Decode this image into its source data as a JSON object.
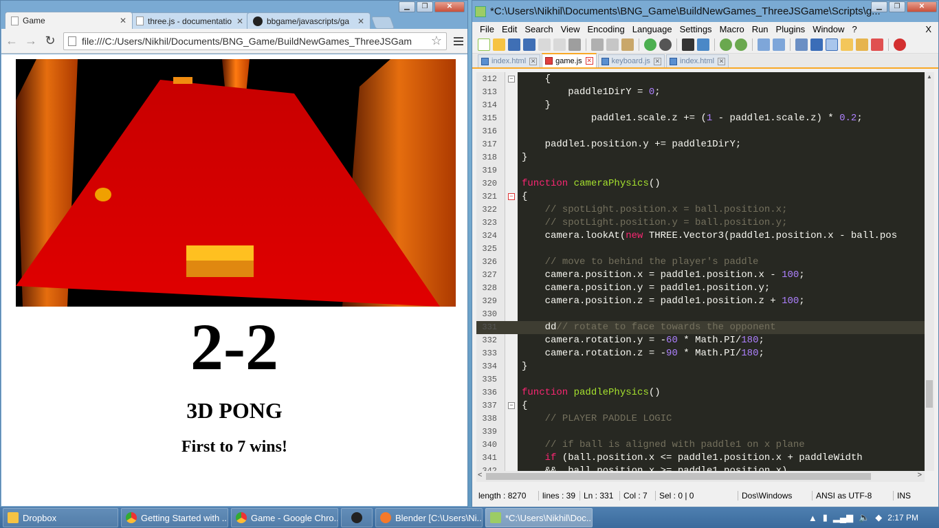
{
  "browser": {
    "tabs": [
      {
        "label": "Game",
        "icon": "page-icon"
      },
      {
        "label": "three.js - documentatio",
        "icon": "page-icon"
      },
      {
        "label": "bbgame/javascripts/ga",
        "icon": "github-icon"
      }
    ],
    "address": "file:///C:/Users/Nikhil/Documents/BNG_Game/BuildNewGames_ThreeJSGam",
    "page": {
      "score": "2-2",
      "title": "3D PONG",
      "subtitle": "First to 7 wins!"
    }
  },
  "editor": {
    "window_title": "*C:\\Users\\Nikhil\\Documents\\BNG_Game\\BuildNewGames_ThreeJSGame\\Scripts\\g...",
    "menu": [
      "File",
      "Edit",
      "Search",
      "View",
      "Encoding",
      "Language",
      "Settings",
      "Macro",
      "Run",
      "Plugins",
      "Window",
      "?"
    ],
    "close_x": "X",
    "tabs": [
      {
        "label": "index.html",
        "active": false
      },
      {
        "label": "game.js",
        "active": true
      },
      {
        "label": "keyboard.js",
        "active": false
      },
      {
        "label": "index.html",
        "active": false
      }
    ],
    "status": {
      "length": "length : 8270",
      "lines": "lines : 39",
      "pos": "Ln : 331",
      "col": "Col : 7",
      "sel": "Sel : 0 | 0",
      "eol": "Dos\\Windows",
      "enc": "ANSI as UTF-8",
      "mode": "INS"
    }
  },
  "taskbar": {
    "items": [
      "Dropbox",
      "Getting Started with ...",
      "Game - Google Chro...",
      "",
      "Blender [C:\\Users\\Ni...",
      "*C:\\Users\\Nikhil\\Doc..."
    ],
    "time": "2:17 PM"
  },
  "colors": {
    "accent": "#f9a825",
    "editor_bg": "#272822"
  }
}
